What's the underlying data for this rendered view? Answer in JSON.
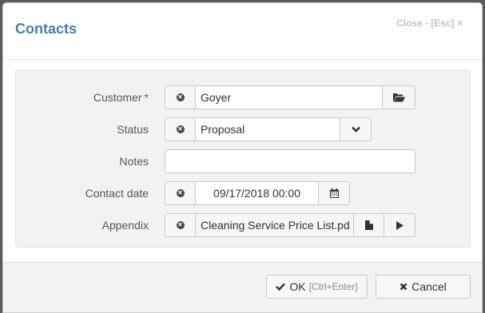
{
  "dialog": {
    "title": "Contacts",
    "close_label": "Close - [Esc] ×"
  },
  "form": {
    "customer": {
      "label": "Customer",
      "required_mark": "*",
      "value": "Goyer",
      "clear_icon": "clear-icon",
      "browse_icon": "folder-open-icon"
    },
    "status": {
      "label": "Status",
      "value": "Proposal",
      "clear_icon": "clear-icon",
      "dropdown_icon": "chevron-down-icon"
    },
    "notes": {
      "label": "Notes",
      "value": ""
    },
    "contact_date": {
      "label": "Contact date",
      "value": "09/17/2018 00:00",
      "clear_icon": "clear-icon",
      "calendar_icon": "calendar-icon"
    },
    "appendix": {
      "label": "Appendix",
      "value": "Cleaning Service Price List.pd",
      "clear_icon": "clear-icon",
      "file_icon": "file-icon",
      "play_icon": "play-icon"
    }
  },
  "footer": {
    "ok_label": "OK",
    "ok_hint": "[Ctrl+Enter]",
    "cancel_label": "Cancel"
  },
  "colors": {
    "title": "#4a7ca8",
    "required": "#c03a2b",
    "panel_bg": "#f2f2f2"
  }
}
